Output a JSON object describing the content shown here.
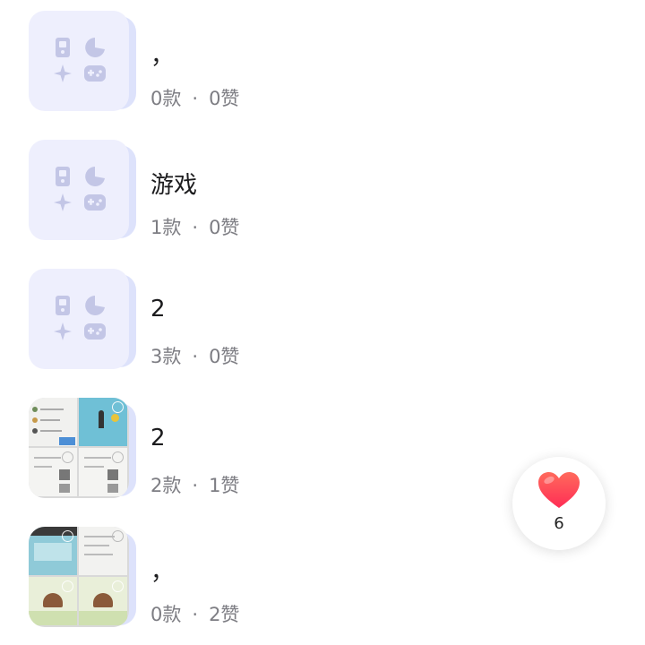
{
  "collections": [
    {
      "title": "，",
      "items_count": "0款",
      "separator": "·",
      "likes_count": "0赞",
      "thumbnail": "game-placeholder"
    },
    {
      "title": "游戏",
      "items_count": "1款",
      "separator": "·",
      "likes_count": "0赞",
      "thumbnail": "game-placeholder"
    },
    {
      "title": "2",
      "items_count": "3款",
      "separator": "·",
      "likes_count": "0赞",
      "thumbnail": "game-placeholder"
    },
    {
      "title": "2",
      "items_count": "2款",
      "separator": "·",
      "likes_count": "1赞",
      "thumbnail": "screenshot-collage"
    },
    {
      "title": "，",
      "items_count": "0款",
      "separator": "·",
      "likes_count": "2赞",
      "thumbnail": "screenshot-collage"
    }
  ],
  "like_button": {
    "icon": "heart-icon",
    "count": "6"
  },
  "colors": {
    "placeholder_bg": "#eeeffd",
    "placeholder_icon": "#c3c6e6",
    "heart": "#ff3b4e"
  }
}
